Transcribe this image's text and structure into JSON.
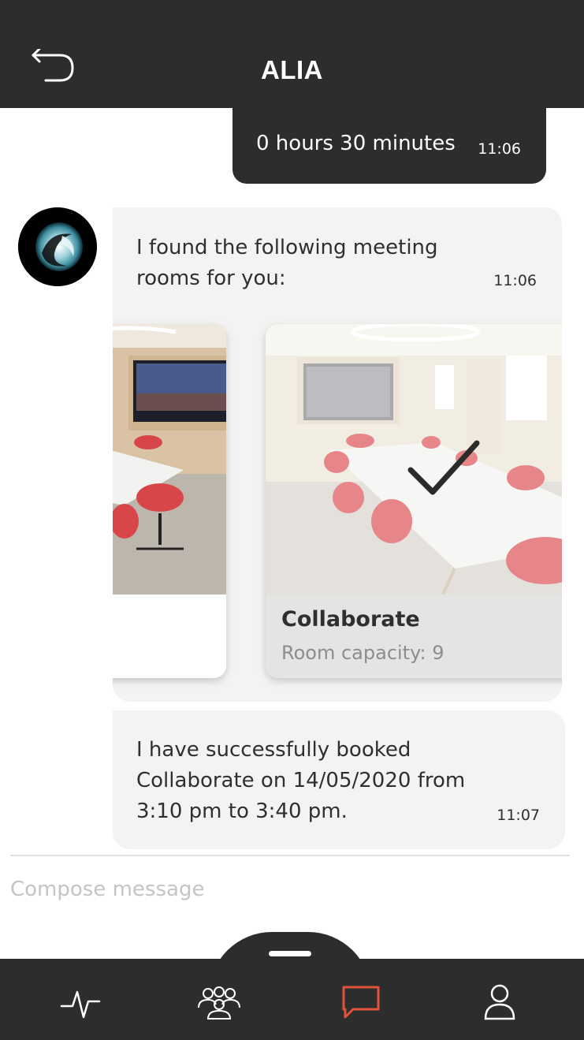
{
  "header": {
    "title": "ALIA",
    "back_icon": "back-arrow-icon"
  },
  "colors": {
    "dark": "#2d2d2d",
    "bubble": "#f4f3f1",
    "accent": "#e0533a",
    "muted": "#8d8d8d"
  },
  "messages": {
    "user_duration": {
      "text": "0 hours 30 minutes",
      "time": "11:06"
    },
    "bot_rooms": {
      "text": "I found the following meeting rooms for you:",
      "time": "11:06"
    },
    "bot_confirm": {
      "text": "I have successfully booked Collaborate on 14/05/2020 from 3:10 pm to 3:40 pm.",
      "time": "11:07"
    }
  },
  "rooms": [
    {
      "name": "",
      "capacity": ""
    },
    {
      "name": "Collaborate",
      "capacity": "Room capacity: 9",
      "selected": true
    }
  ],
  "composer": {
    "placeholder": "Compose message"
  },
  "bottom_nav": [
    {
      "icon": "activity-icon",
      "active": false
    },
    {
      "icon": "group-icon",
      "active": false
    },
    {
      "icon": "chat-icon",
      "active": true
    },
    {
      "icon": "profile-icon",
      "active": false
    }
  ]
}
